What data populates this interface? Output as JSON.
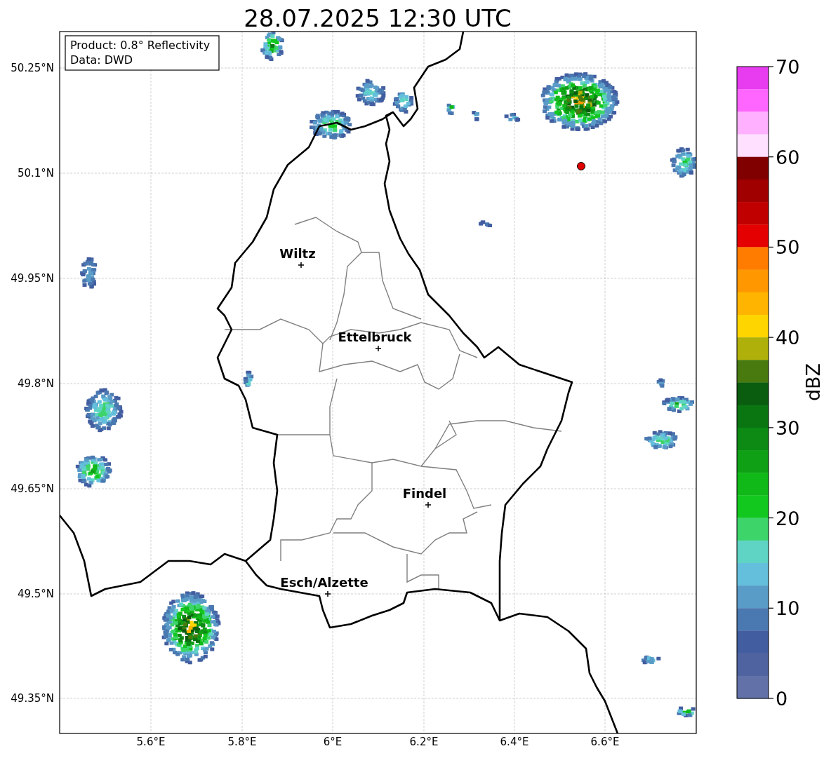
{
  "title": "28.07.2025 12:30 UTC",
  "map": {
    "info_box": [
      "Product: 0.8° Reflectivity",
      "Data: DWD"
    ],
    "lat_labels": [
      "50.25°N",
      "50.1°N",
      "49.95°N",
      "49.8°N",
      "49.65°N",
      "49.5°N",
      "49.35°N"
    ],
    "lon_labels": [
      "5.6°E",
      "5.8°E",
      "6°E",
      "6.2°E",
      "6.4°E",
      "6.6°E"
    ],
    "places": [
      {
        "name": "Wiltz"
      },
      {
        "name": "Ettelbruck"
      },
      {
        "name": "Findel"
      },
      {
        "name": "Esch/Alzette"
      }
    ]
  },
  "colorbar": {
    "label": "dBZ",
    "ticks": [
      "70",
      "60",
      "50",
      "40",
      "30",
      "20",
      "10",
      "0"
    ],
    "bins": [
      {
        "color": "#e83cf0"
      },
      {
        "color": "#ff66ff"
      },
      {
        "color": "#ffb0ff"
      },
      {
        "color": "#ffe0ff"
      },
      {
        "color": "#800000"
      },
      {
        "color": "#a00000"
      },
      {
        "color": "#c00000"
      },
      {
        "color": "#e40000"
      },
      {
        "color": "#ff7c00"
      },
      {
        "color": "#ff9800"
      },
      {
        "color": "#ffb400"
      },
      {
        "color": "#ffd500"
      },
      {
        "color": "#b0b00a"
      },
      {
        "color": "#487a10"
      },
      {
        "color": "#0a5c0e"
      },
      {
        "color": "#0a7612"
      },
      {
        "color": "#0c8a14"
      },
      {
        "color": "#0fa016"
      },
      {
        "color": "#10b818"
      },
      {
        "color": "#12c81e"
      },
      {
        "color": "#3dd46a"
      },
      {
        "color": "#5fd4c4"
      },
      {
        "color": "#64bfdc"
      },
      {
        "color": "#5a9cc8"
      },
      {
        "color": "#4a78b0"
      },
      {
        "color": "#425ea0"
      },
      {
        "color": "#4f63a0"
      },
      {
        "color": "#6272a8"
      }
    ]
  }
}
